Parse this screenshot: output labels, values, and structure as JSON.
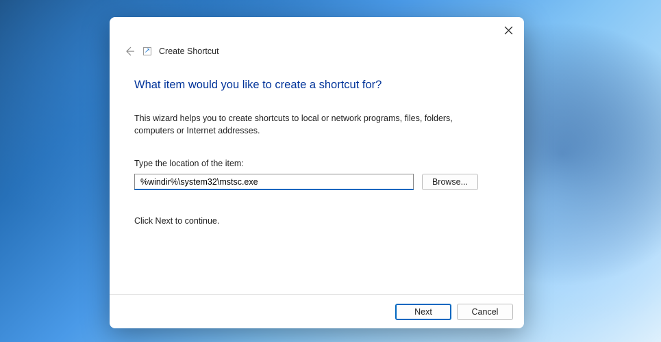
{
  "dialog": {
    "wizardTitle": "Create Shortcut",
    "heading": "What item would you like to create a shortcut for?",
    "description": "This wizard helps you to create shortcuts to local or network programs, files, folders, computers or Internet addresses.",
    "inputLabel": "Type the location of the item:",
    "inputValue": "%windir%\\system32\\mstsc.exe",
    "browseLabel": "Browse...",
    "continueText": "Click Next to continue.",
    "nextLabel": "Next",
    "cancelLabel": "Cancel"
  }
}
